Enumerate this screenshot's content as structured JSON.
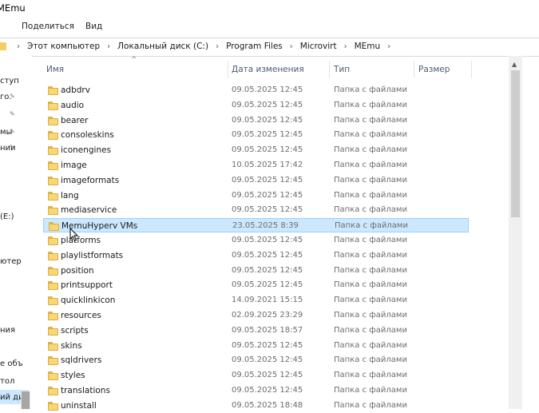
{
  "window": {
    "title": "MEmu"
  },
  "ribbon": {
    "tabs": [
      "Поделиться",
      "Вид"
    ]
  },
  "address": {
    "crumbs": [
      "Этот компьютер",
      "Локальный диск (C:)",
      "Program Files",
      "Microvirt",
      "MEmu"
    ]
  },
  "nav_pane": {
    "items": [
      {
        "label": "ступ",
        "pinned": false
      },
      {
        "label": "го.",
        "pinned": true
      },
      {
        "label": "",
        "pinned": true
      },
      {
        "label": "мы",
        "pinned": true
      },
      {
        "label": "нии",
        "pinned": true
      },
      {
        "label": "(E:)",
        "pinned": false
      },
      {
        "label": "ютер",
        "pinned": false
      },
      {
        "label": "",
        "pinned": false
      },
      {
        "label": "ния",
        "pinned": false
      },
      {
        "label": "е объ",
        "pinned": false
      },
      {
        "label": "тол",
        "pinned": false
      },
      {
        "label": "ий дис",
        "pinned": false
      }
    ]
  },
  "columns": {
    "name": "Имя",
    "date": "Дата изменения",
    "type": "Тип",
    "size": "Размер"
  },
  "files": [
    {
      "name": "adbdrv",
      "date": "09.05.2025 12:45",
      "type": "Папка с файлами"
    },
    {
      "name": "audio",
      "date": "09.05.2025 12:45",
      "type": "Папка с файлами"
    },
    {
      "name": "bearer",
      "date": "09.05.2025 12:45",
      "type": "Папка с файлами"
    },
    {
      "name": "consoleskins",
      "date": "09.05.2025 12:45",
      "type": "Папка с файлами"
    },
    {
      "name": "iconengines",
      "date": "09.05.2025 12:45",
      "type": "Папка с файлами"
    },
    {
      "name": "image",
      "date": "10.05.2025 17:42",
      "type": "Папка с файлами"
    },
    {
      "name": "imageformats",
      "date": "09.05.2025 12:45",
      "type": "Папка с файлами"
    },
    {
      "name": "lang",
      "date": "09.05.2025 12:45",
      "type": "Папка с файлами"
    },
    {
      "name": "mediaservice",
      "date": "09.05.2025 12:45",
      "type": "Папка с файлами"
    },
    {
      "name": "MemuHyperv VMs",
      "date": "23.05.2025 8:39",
      "type": "Папка с файлами"
    },
    {
      "name": "platforms",
      "date": "09.05.2025 12:45",
      "type": "Папка с файлами"
    },
    {
      "name": "playlistformats",
      "date": "09.05.2025 12:45",
      "type": "Папка с файлами"
    },
    {
      "name": "position",
      "date": "09.05.2025 12:45",
      "type": "Папка с файлами"
    },
    {
      "name": "printsupport",
      "date": "09.05.2025 12:45",
      "type": "Папка с файлами"
    },
    {
      "name": "quicklinkicon",
      "date": "14.09.2021 15:15",
      "type": "Папка с файлами"
    },
    {
      "name": "resources",
      "date": "02.09.2025 23:29",
      "type": "Папка с файлами"
    },
    {
      "name": "scripts",
      "date": "09.05.2025 18:57",
      "type": "Папка с файлами"
    },
    {
      "name": "skins",
      "date": "09.05.2025 12:45",
      "type": "Папка с файлами"
    },
    {
      "name": "sqldrivers",
      "date": "09.05.2025 12:45",
      "type": "Папка с файлами"
    },
    {
      "name": "styles",
      "date": "09.05.2025 12:45",
      "type": "Папка с файлами"
    },
    {
      "name": "translations",
      "date": "09.05.2025 12:45",
      "type": "Папка с файлами"
    },
    {
      "name": "uninstall",
      "date": "09.05.2025 18:48",
      "type": "Папка с файлами"
    }
  ],
  "highlighted_file": "MemuHyperv VMs",
  "colors": {
    "selection": "#cce8ff",
    "selection_border": "#99d1ff",
    "folder": "#f8d775",
    "header_text": "#4a5b78"
  }
}
